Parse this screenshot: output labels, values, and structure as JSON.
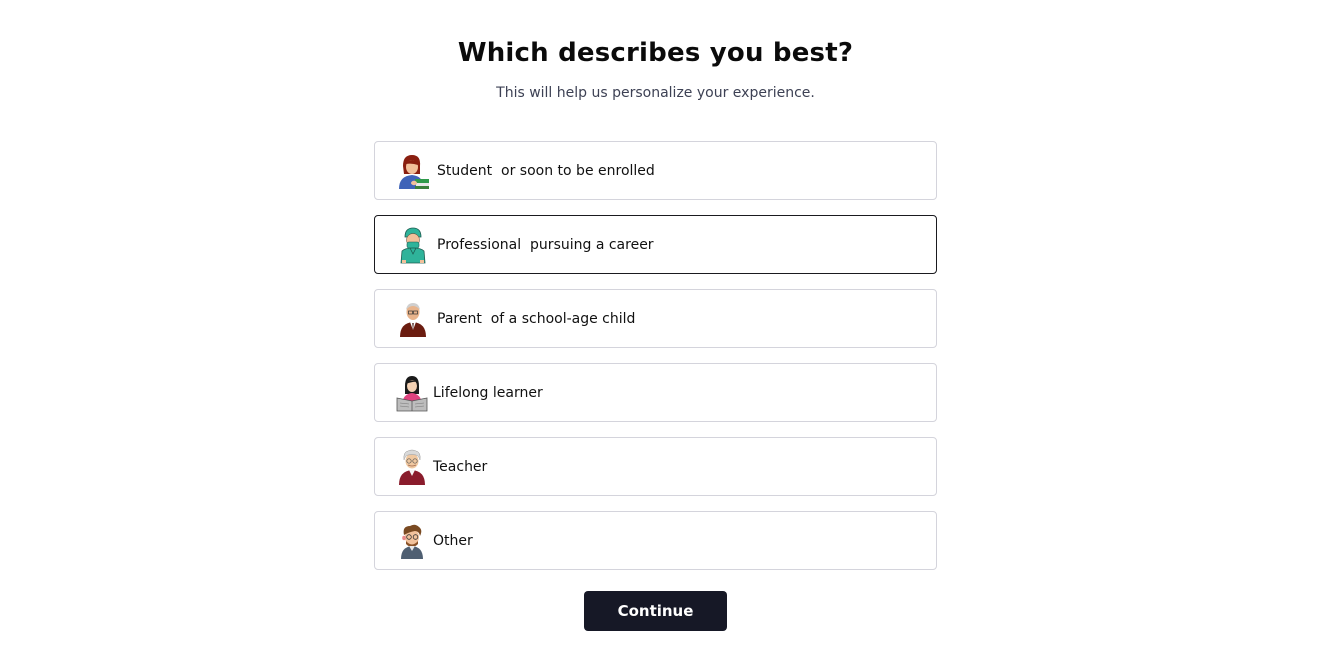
{
  "header": {
    "title": "Which describes you best?",
    "subtitle": "This will help us personalize your experience."
  },
  "options": [
    {
      "label": "Student",
      "extra": "or soon to be enrolled",
      "icon": "student-avatar-icon",
      "selected": false
    },
    {
      "label": "Professional",
      "extra": "pursuing a career",
      "icon": "professional-avatar-icon",
      "selected": true
    },
    {
      "label": "Parent",
      "extra": "of a school-age child",
      "icon": "parent-avatar-icon",
      "selected": false
    },
    {
      "label": "Lifelong learner",
      "extra": "",
      "icon": "lifelong-learner-avatar-icon",
      "selected": false
    },
    {
      "label": "Teacher",
      "extra": "",
      "icon": "teacher-avatar-icon",
      "selected": false
    },
    {
      "label": "Other",
      "extra": "",
      "icon": "other-avatar-icon",
      "selected": false
    }
  ],
  "footer": {
    "continue_label": "Continue"
  },
  "colors": {
    "button_bg": "#161826",
    "selected_border": "#1a1a1f",
    "default_border": "#d4d4dc"
  }
}
